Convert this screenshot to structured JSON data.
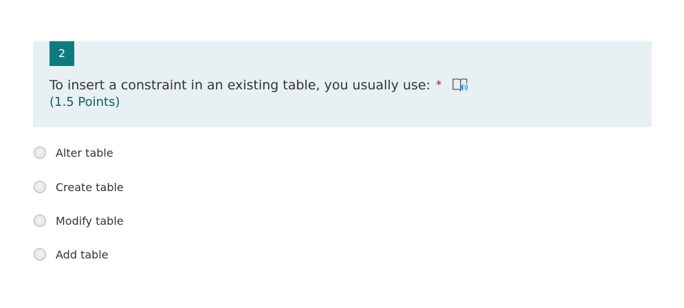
{
  "question": {
    "number": "2",
    "title": "To insert a constraint in an existing table, you usually use:",
    "required_marker": "*",
    "points": "(1.5 Points)",
    "reader_icon": "immersive-reader-icon"
  },
  "options": [
    {
      "label": "Alter table",
      "selected": false
    },
    {
      "label": "Create table",
      "selected": false
    },
    {
      "label": "Modify table",
      "selected": false
    },
    {
      "label": "Add table",
      "selected": false
    }
  ],
  "colors": {
    "number_badge": "#0f7b7e",
    "header_background": "#e8f0f4",
    "points_text": "#0f5f62",
    "required_marker": "#a4262c",
    "reader_icon_accent": "#2e9bd6"
  }
}
